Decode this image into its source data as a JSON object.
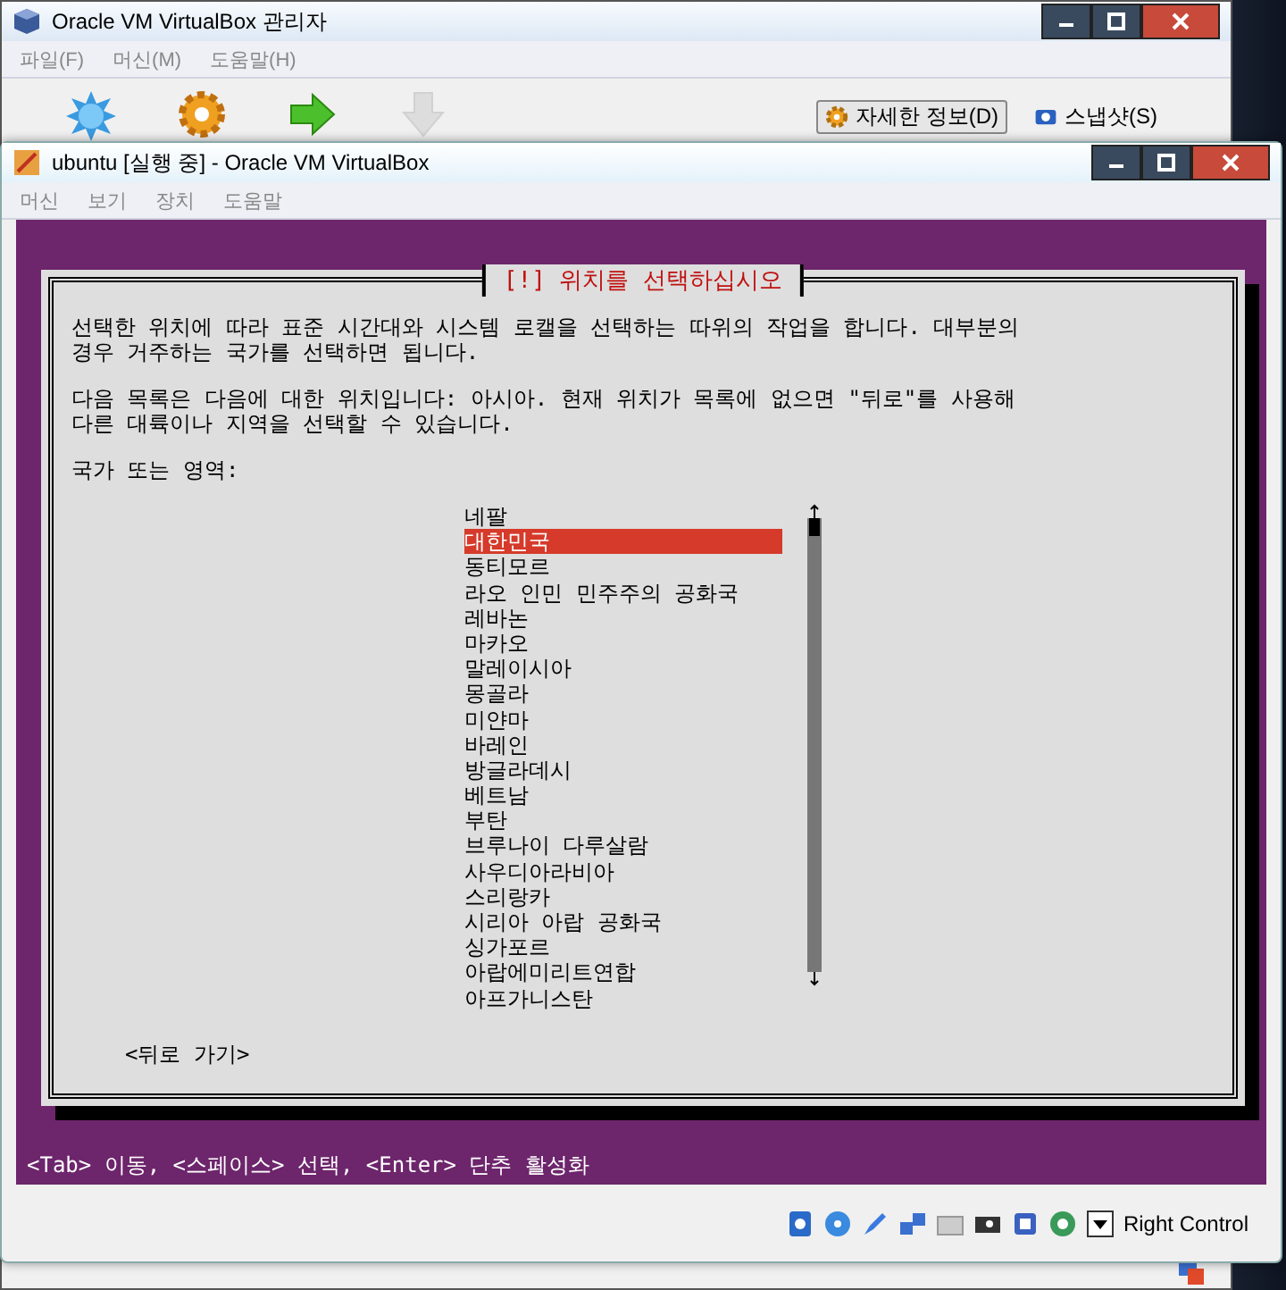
{
  "manager": {
    "title": "Oracle VM VirtualBox 관리자",
    "menu": [
      "파일(F)",
      "머신(M)",
      "도움말(H)"
    ],
    "tools": [
      {
        "kind": "new",
        "disabled": false
      },
      {
        "kind": "settings",
        "disabled": false
      },
      {
        "kind": "start",
        "disabled": false
      },
      {
        "kind": "discard",
        "disabled": true
      }
    ],
    "view_buttons": [
      {
        "label": "자세한 정보(D)",
        "kind": "details",
        "selected": true
      },
      {
        "label": "스냅샷(S)",
        "kind": "snapshots",
        "selected": false
      }
    ]
  },
  "vm": {
    "title": "ubuntu [실행 중] - Oracle VM VirtualBox",
    "menu": [
      "머신",
      "보기",
      "장치",
      "도움말"
    ],
    "dialog": {
      "title": "[!] 위치를 선택하십시오",
      "paragraphs": [
        [
          "선택한 위치에 따라 표준 시간대와 시스템 로캘을 선택하는 따위의 작업을 합니다. 대부분의",
          "경우 거주하는 국가를 선택하면 됩니다."
        ],
        [
          "다음 목록은 다음에 대한 위치입니다: 아시아. 현재 위치가 목록에 없으면 \"뒤로\"를 사용해",
          "다른 대륙이나 지역을 선택할 수 있습니다."
        ]
      ],
      "prompt": "국가 또는 영역:",
      "countries": [
        {
          "label": "네팔",
          "selected": false
        },
        {
          "label": "대한민국",
          "selected": true
        },
        {
          "label": "동티모르",
          "selected": false
        },
        {
          "label": "라오 인민 민주주의 공화국",
          "selected": false
        },
        {
          "label": "레바논",
          "selected": false
        },
        {
          "label": "마카오",
          "selected": false
        },
        {
          "label": "말레이시아",
          "selected": false
        },
        {
          "label": "몽골라",
          "selected": false
        },
        {
          "label": "미얀마",
          "selected": false
        },
        {
          "label": "바레인",
          "selected": false
        },
        {
          "label": "방글라데시",
          "selected": false
        },
        {
          "label": "베트남",
          "selected": false
        },
        {
          "label": "부탄",
          "selected": false
        },
        {
          "label": "브루나이 다루살람",
          "selected": false
        },
        {
          "label": "사우디아라비아",
          "selected": false
        },
        {
          "label": "스리랑카",
          "selected": false
        },
        {
          "label": "시리아 아랍 공화국",
          "selected": false
        },
        {
          "label": "싱가포르",
          "selected": false
        },
        {
          "label": "아랍에미리트연합",
          "selected": false
        },
        {
          "label": "아프가니스탄",
          "selected": false
        }
      ],
      "back_button": "<뒤로 가기>"
    },
    "help_line": "<Tab> 이동, <스페이스> 선택, <Enter> 단추 활성화",
    "host_key": "Right Control"
  }
}
